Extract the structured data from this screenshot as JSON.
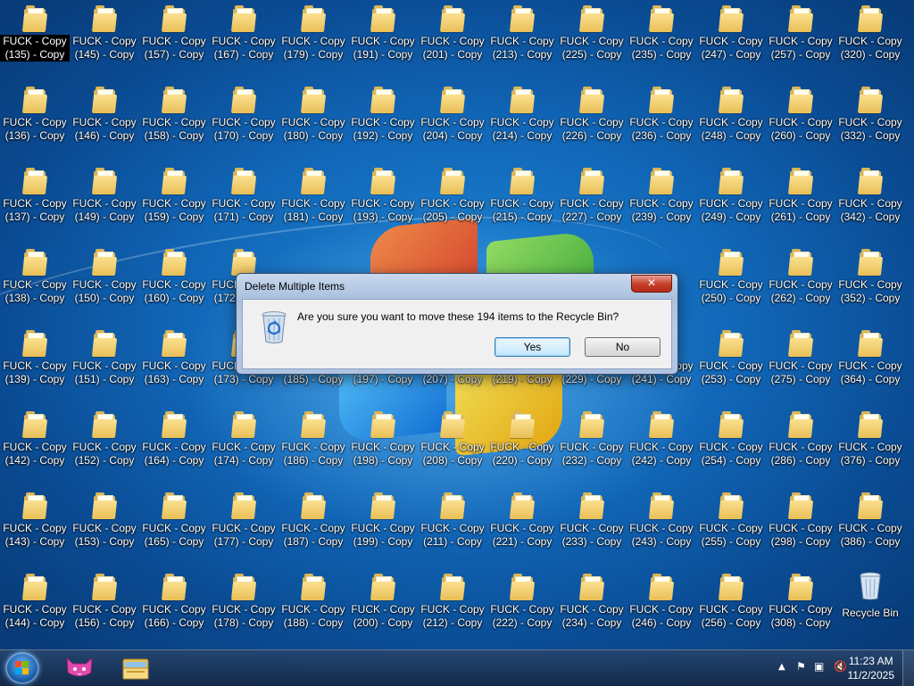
{
  "desktop": {
    "icons": [
      {
        "label": "FUCK - Copy (135) - Copy",
        "selected": true
      },
      {
        "label": "FUCK - Copy (145) - Copy"
      },
      {
        "label": "FUCK - Copy (157) - Copy"
      },
      {
        "label": "FUCK - Copy (167) - Copy"
      },
      {
        "label": "FUCK - Copy (179) - Copy"
      },
      {
        "label": "FUCK - Copy (191) - Copy"
      },
      {
        "label": "FUCK - Copy (201) - Copy"
      },
      {
        "label": "FUCK - Copy (213) - Copy"
      },
      {
        "label": "FUCK - Copy (225) - Copy"
      },
      {
        "label": "FUCK - Copy (235) - Copy"
      },
      {
        "label": "FUCK - Copy (247) - Copy"
      },
      {
        "label": "FUCK - Copy (257) - Copy"
      },
      {
        "label": "FUCK - Copy (320) - Copy"
      },
      {
        "label": "FUCK - Copy (136) - Copy"
      },
      {
        "label": "FUCK - Copy (146) - Copy"
      },
      {
        "label": "FUCK - Copy (158) - Copy"
      },
      {
        "label": "FUCK - Copy (170) - Copy"
      },
      {
        "label": "FUCK - Copy (180) - Copy"
      },
      {
        "label": "FUCK - Copy (192) - Copy"
      },
      {
        "label": "FUCK - Copy (204) - Copy"
      },
      {
        "label": "FUCK - Copy (214) - Copy"
      },
      {
        "label": "FUCK - Copy (226) - Copy"
      },
      {
        "label": "FUCK - Copy (236) - Copy"
      },
      {
        "label": "FUCK - Copy (248) - Copy"
      },
      {
        "label": "FUCK - Copy (260) - Copy"
      },
      {
        "label": "FUCK - Copy (332) - Copy"
      },
      {
        "label": "FUCK - Copy (137) - Copy"
      },
      {
        "label": "FUCK - Copy (149) - Copy"
      },
      {
        "label": "FUCK - Copy (159) - Copy"
      },
      {
        "label": "FUCK - Copy (171) - Copy"
      },
      {
        "label": "FUCK - Copy (181) - Copy"
      },
      {
        "label": "FUCK - Copy (193) - Copy"
      },
      {
        "label": "FUCK - Copy (205) - Copy"
      },
      {
        "label": "FUCK - Copy (215) - Copy"
      },
      {
        "label": "FUCK - Copy (227) - Copy"
      },
      {
        "label": "FUCK - Copy (239) - Copy"
      },
      {
        "label": "FUCK - Copy (249) - Copy"
      },
      {
        "label": "FUCK - Copy (261) - Copy"
      },
      {
        "label": "FUCK - Copy (342) - Copy"
      },
      {
        "label": "FUCK - Copy (138) - Copy"
      },
      {
        "label": "FUCK - Copy (150) - Copy"
      },
      {
        "label": "FUCK - Copy (160) - Copy"
      },
      {
        "label": "FUCK - Copy (172) - Copy"
      },
      {
        "label": ""
      },
      {
        "label": ""
      },
      {
        "label": ""
      },
      {
        "label": ""
      },
      {
        "label": ""
      },
      {
        "label": ""
      },
      {
        "label": "FUCK - Copy (250) - Copy"
      },
      {
        "label": "FUCK - Copy (262) - Copy"
      },
      {
        "label": "FUCK - Copy (352) - Copy"
      },
      {
        "label": "FUCK - Copy (139) - Copy"
      },
      {
        "label": "FUCK - Copy (151) - Copy"
      },
      {
        "label": "FUCK - Copy (163) - Copy"
      },
      {
        "label": "FUCK - Copy (173) - Copy"
      },
      {
        "label": "FUCK - Copy (185) - Copy"
      },
      {
        "label": "FUCK - Copy (197) - Copy"
      },
      {
        "label": "FUCK - Copy (207) - Copy"
      },
      {
        "label": "FUCK - Copy (219) - Copy"
      },
      {
        "label": "FUCK - Copy (229) - Copy"
      },
      {
        "label": "FUCK - Copy (241) - Copy"
      },
      {
        "label": "FUCK - Copy (253) - Copy"
      },
      {
        "label": "FUCK - Copy (275) - Copy"
      },
      {
        "label": "FUCK - Copy (364) - Copy"
      },
      {
        "label": "FUCK - Copy (142) - Copy"
      },
      {
        "label": "FUCK - Copy (152) - Copy"
      },
      {
        "label": "FUCK - Copy (164) - Copy"
      },
      {
        "label": "FUCK - Copy (174) - Copy"
      },
      {
        "label": "FUCK - Copy (186) - Copy"
      },
      {
        "label": "FUCK - Copy (198) - Copy"
      },
      {
        "label": "FUCK - Copy (208) - Copy"
      },
      {
        "label": "FUCK - Copy (220) - Copy"
      },
      {
        "label": "FUCK - Copy (232) - Copy"
      },
      {
        "label": "FUCK - Copy (242) - Copy"
      },
      {
        "label": "FUCK - Copy (254) - Copy"
      },
      {
        "label": "FUCK - Copy (286) - Copy"
      },
      {
        "label": "FUCK - Copy (376) - Copy"
      },
      {
        "label": "FUCK - Copy (143) - Copy"
      },
      {
        "label": "FUCK - Copy (153) - Copy"
      },
      {
        "label": "FUCK - Copy (165) - Copy"
      },
      {
        "label": "FUCK - Copy (177) - Copy"
      },
      {
        "label": "FUCK - Copy (187) - Copy"
      },
      {
        "label": "FUCK - Copy (199) - Copy"
      },
      {
        "label": "FUCK - Copy (211) - Copy"
      },
      {
        "label": "FUCK - Copy (221) - Copy"
      },
      {
        "label": "FUCK - Copy (233) - Copy"
      },
      {
        "label": "FUCK - Copy (243) - Copy"
      },
      {
        "label": "FUCK - Copy (255) - Copy"
      },
      {
        "label": "FUCK - Copy (298) - Copy"
      },
      {
        "label": "FUCK - Copy (386) - Copy"
      },
      {
        "label": "FUCK - Copy (144) - Copy"
      },
      {
        "label": "FUCK - Copy (156) - Copy"
      },
      {
        "label": "FUCK - Copy (166) - Copy"
      },
      {
        "label": "FUCK - Copy (178) - Copy"
      },
      {
        "label": "FUCK - Copy (188) - Copy"
      },
      {
        "label": "FUCK - Copy (200) - Copy"
      },
      {
        "label": "FUCK - Copy (212) - Copy"
      },
      {
        "label": "FUCK - Copy (222) - Copy"
      },
      {
        "label": "FUCK - Copy (234) - Copy"
      },
      {
        "label": "FUCK - Copy (246) - Copy"
      },
      {
        "label": "FUCK - Copy (256) - Copy"
      },
      {
        "label": "FUCK - Copy (308) - Copy"
      },
      {
        "label": "Recycle Bin",
        "type": "recycle-bin"
      }
    ]
  },
  "dialog": {
    "title": "Delete Multiple Items",
    "close_label": "✕",
    "message": "Are you sure you want to move these 194 items to the Recycle Bin?",
    "yes_label": "Yes",
    "no_label": "No",
    "icon": "recycle-bin-icon"
  },
  "taskbar": {
    "start_icon": "windows-start-icon",
    "apps": [
      {
        "icon": "cat-app-icon"
      },
      {
        "icon": "file-explorer-icon"
      }
    ],
    "tray": {
      "time": "11:23 AM",
      "date": "11/2/2025",
      "icons": [
        "show-hidden-icons-arrow",
        "action-center-flag-icon",
        "network-icon",
        "volume-muted-icon"
      ]
    }
  },
  "colors": {
    "desktop_bg": "#1166b7",
    "folder": "#e8bf57",
    "dialog_close": "#c7422a"
  }
}
